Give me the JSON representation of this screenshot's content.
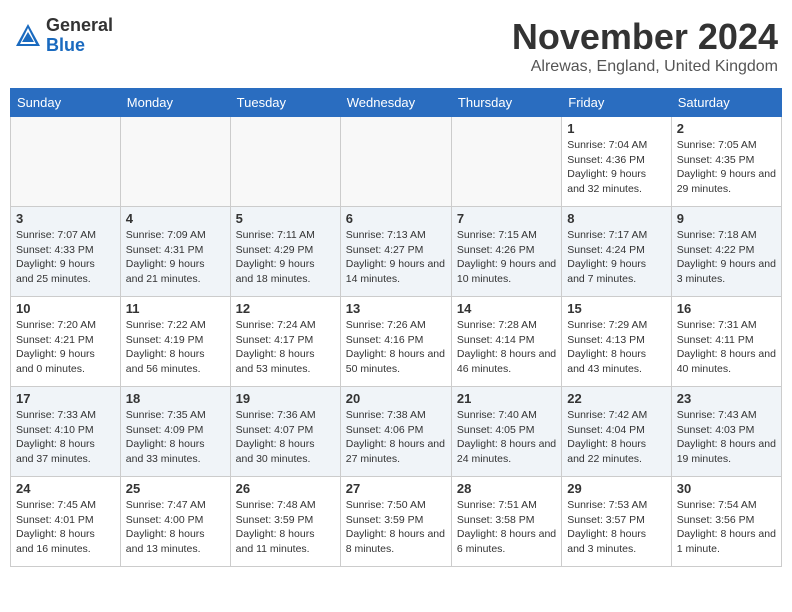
{
  "header": {
    "logo_general": "General",
    "logo_blue": "Blue",
    "month_title": "November 2024",
    "location": "Alrewas, England, United Kingdom"
  },
  "days_of_week": [
    "Sunday",
    "Monday",
    "Tuesday",
    "Wednesday",
    "Thursday",
    "Friday",
    "Saturday"
  ],
  "weeks": [
    [
      {
        "day": "",
        "info": ""
      },
      {
        "day": "",
        "info": ""
      },
      {
        "day": "",
        "info": ""
      },
      {
        "day": "",
        "info": ""
      },
      {
        "day": "",
        "info": ""
      },
      {
        "day": "1",
        "info": "Sunrise: 7:04 AM\nSunset: 4:36 PM\nDaylight: 9 hours and 32 minutes."
      },
      {
        "day": "2",
        "info": "Sunrise: 7:05 AM\nSunset: 4:35 PM\nDaylight: 9 hours and 29 minutes."
      }
    ],
    [
      {
        "day": "3",
        "info": "Sunrise: 7:07 AM\nSunset: 4:33 PM\nDaylight: 9 hours and 25 minutes."
      },
      {
        "day": "4",
        "info": "Sunrise: 7:09 AM\nSunset: 4:31 PM\nDaylight: 9 hours and 21 minutes."
      },
      {
        "day": "5",
        "info": "Sunrise: 7:11 AM\nSunset: 4:29 PM\nDaylight: 9 hours and 18 minutes."
      },
      {
        "day": "6",
        "info": "Sunrise: 7:13 AM\nSunset: 4:27 PM\nDaylight: 9 hours and 14 minutes."
      },
      {
        "day": "7",
        "info": "Sunrise: 7:15 AM\nSunset: 4:26 PM\nDaylight: 9 hours and 10 minutes."
      },
      {
        "day": "8",
        "info": "Sunrise: 7:17 AM\nSunset: 4:24 PM\nDaylight: 9 hours and 7 minutes."
      },
      {
        "day": "9",
        "info": "Sunrise: 7:18 AM\nSunset: 4:22 PM\nDaylight: 9 hours and 3 minutes."
      }
    ],
    [
      {
        "day": "10",
        "info": "Sunrise: 7:20 AM\nSunset: 4:21 PM\nDaylight: 9 hours and 0 minutes."
      },
      {
        "day": "11",
        "info": "Sunrise: 7:22 AM\nSunset: 4:19 PM\nDaylight: 8 hours and 56 minutes."
      },
      {
        "day": "12",
        "info": "Sunrise: 7:24 AM\nSunset: 4:17 PM\nDaylight: 8 hours and 53 minutes."
      },
      {
        "day": "13",
        "info": "Sunrise: 7:26 AM\nSunset: 4:16 PM\nDaylight: 8 hours and 50 minutes."
      },
      {
        "day": "14",
        "info": "Sunrise: 7:28 AM\nSunset: 4:14 PM\nDaylight: 8 hours and 46 minutes."
      },
      {
        "day": "15",
        "info": "Sunrise: 7:29 AM\nSunset: 4:13 PM\nDaylight: 8 hours and 43 minutes."
      },
      {
        "day": "16",
        "info": "Sunrise: 7:31 AM\nSunset: 4:11 PM\nDaylight: 8 hours and 40 minutes."
      }
    ],
    [
      {
        "day": "17",
        "info": "Sunrise: 7:33 AM\nSunset: 4:10 PM\nDaylight: 8 hours and 37 minutes."
      },
      {
        "day": "18",
        "info": "Sunrise: 7:35 AM\nSunset: 4:09 PM\nDaylight: 8 hours and 33 minutes."
      },
      {
        "day": "19",
        "info": "Sunrise: 7:36 AM\nSunset: 4:07 PM\nDaylight: 8 hours and 30 minutes."
      },
      {
        "day": "20",
        "info": "Sunrise: 7:38 AM\nSunset: 4:06 PM\nDaylight: 8 hours and 27 minutes."
      },
      {
        "day": "21",
        "info": "Sunrise: 7:40 AM\nSunset: 4:05 PM\nDaylight: 8 hours and 24 minutes."
      },
      {
        "day": "22",
        "info": "Sunrise: 7:42 AM\nSunset: 4:04 PM\nDaylight: 8 hours and 22 minutes."
      },
      {
        "day": "23",
        "info": "Sunrise: 7:43 AM\nSunset: 4:03 PM\nDaylight: 8 hours and 19 minutes."
      }
    ],
    [
      {
        "day": "24",
        "info": "Sunrise: 7:45 AM\nSunset: 4:01 PM\nDaylight: 8 hours and 16 minutes."
      },
      {
        "day": "25",
        "info": "Sunrise: 7:47 AM\nSunset: 4:00 PM\nDaylight: 8 hours and 13 minutes."
      },
      {
        "day": "26",
        "info": "Sunrise: 7:48 AM\nSunset: 3:59 PM\nDaylight: 8 hours and 11 minutes."
      },
      {
        "day": "27",
        "info": "Sunrise: 7:50 AM\nSunset: 3:59 PM\nDaylight: 8 hours and 8 minutes."
      },
      {
        "day": "28",
        "info": "Sunrise: 7:51 AM\nSunset: 3:58 PM\nDaylight: 8 hours and 6 minutes."
      },
      {
        "day": "29",
        "info": "Sunrise: 7:53 AM\nSunset: 3:57 PM\nDaylight: 8 hours and 3 minutes."
      },
      {
        "day": "30",
        "info": "Sunrise: 7:54 AM\nSunset: 3:56 PM\nDaylight: 8 hours and 1 minute."
      }
    ]
  ]
}
